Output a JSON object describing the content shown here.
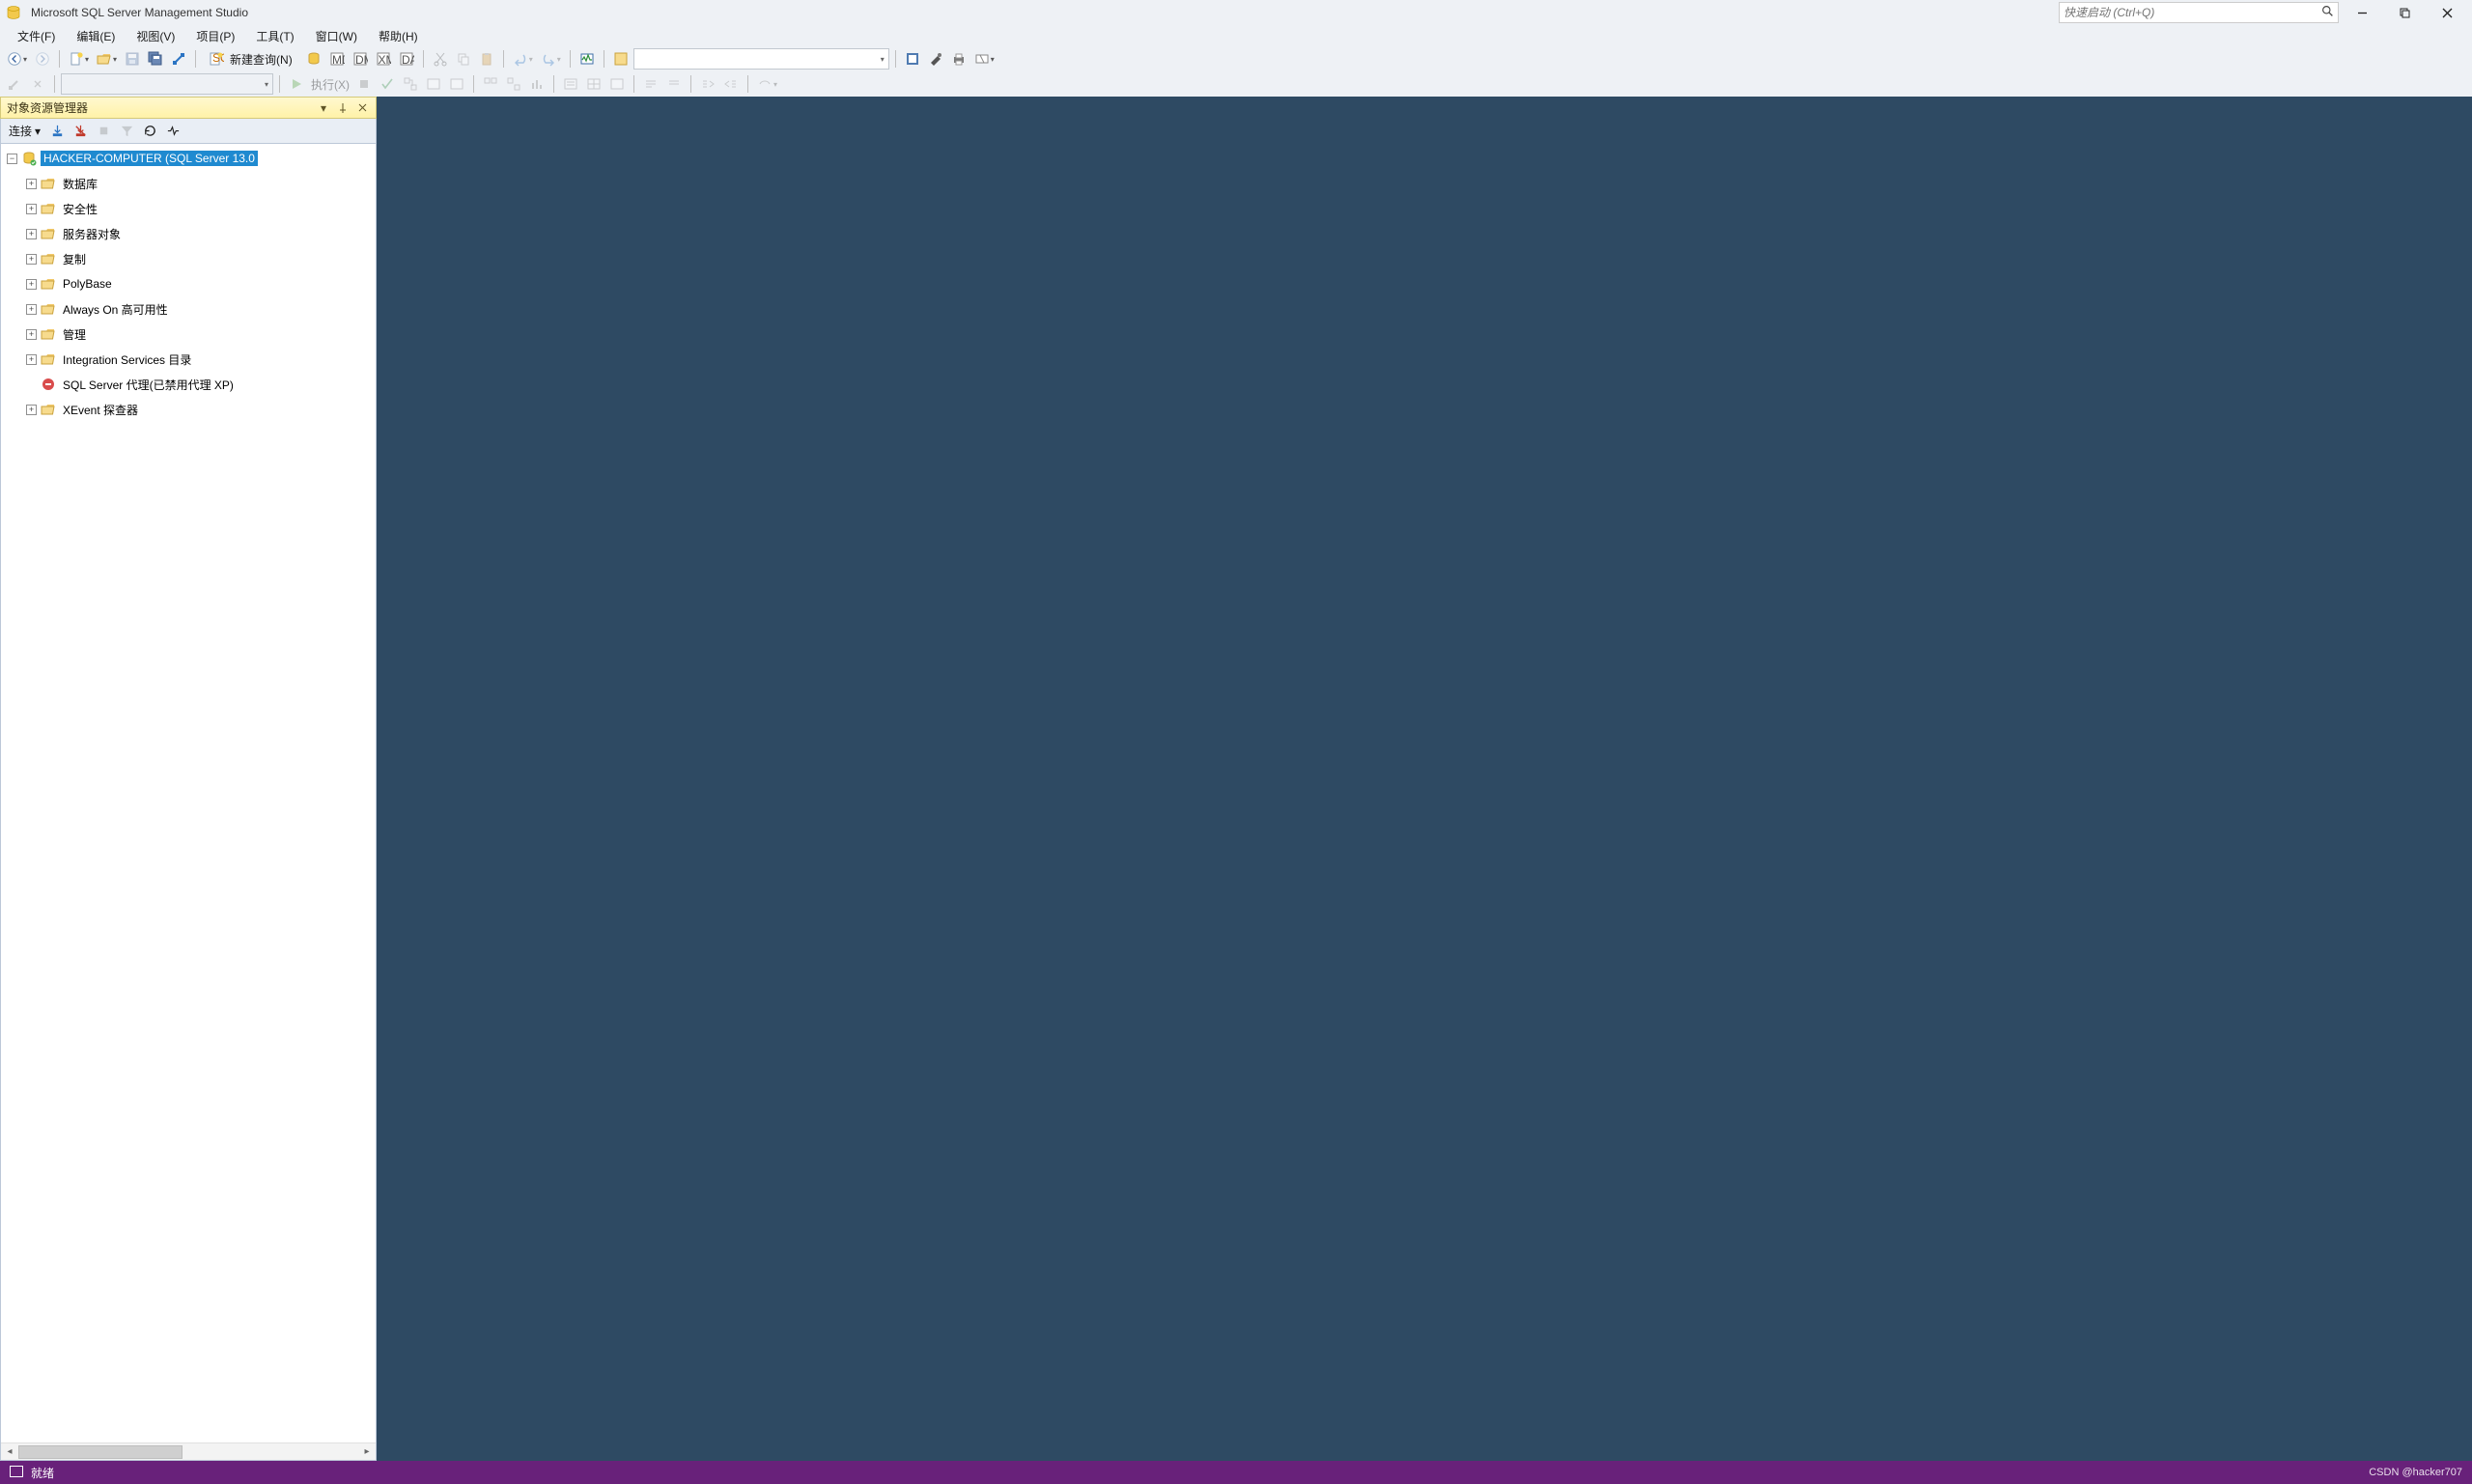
{
  "app": {
    "title": "Microsoft SQL Server Management Studio"
  },
  "quickLaunch": {
    "placeholder": "快速启动 (Ctrl+Q)"
  },
  "menu": {
    "file": "文件(F)",
    "edit": "编辑(E)",
    "view": "视图(V)",
    "project": "项目(P)",
    "tools": "工具(T)",
    "window": "窗口(W)",
    "help": "帮助(H)"
  },
  "toolbar": {
    "newQuery": "新建查询(N)",
    "execute": "执行(X)"
  },
  "objectExplorer": {
    "title": "对象资源管理器",
    "connect": "连接",
    "nodes": {
      "root": "HACKER-COMPUTER (SQL Server 13.0",
      "items": [
        {
          "label": "数据库",
          "icon": "folder",
          "expandable": true
        },
        {
          "label": "安全性",
          "icon": "folder",
          "expandable": true
        },
        {
          "label": "服务器对象",
          "icon": "folder",
          "expandable": true
        },
        {
          "label": "复制",
          "icon": "folder",
          "expandable": true
        },
        {
          "label": "PolyBase",
          "icon": "folder",
          "expandable": true
        },
        {
          "label": "Always On 高可用性",
          "icon": "folder",
          "expandable": true
        },
        {
          "label": "管理",
          "icon": "folder",
          "expandable": true
        },
        {
          "label": "Integration Services 目录",
          "icon": "folder",
          "expandable": true
        },
        {
          "label": "SQL Server 代理(已禁用代理 XP)",
          "icon": "agent",
          "expandable": false
        },
        {
          "label": "XEvent 探查器",
          "icon": "folder",
          "expandable": true
        }
      ]
    }
  },
  "status": {
    "ready": "就绪",
    "watermark": "CSDN @hacker707"
  }
}
